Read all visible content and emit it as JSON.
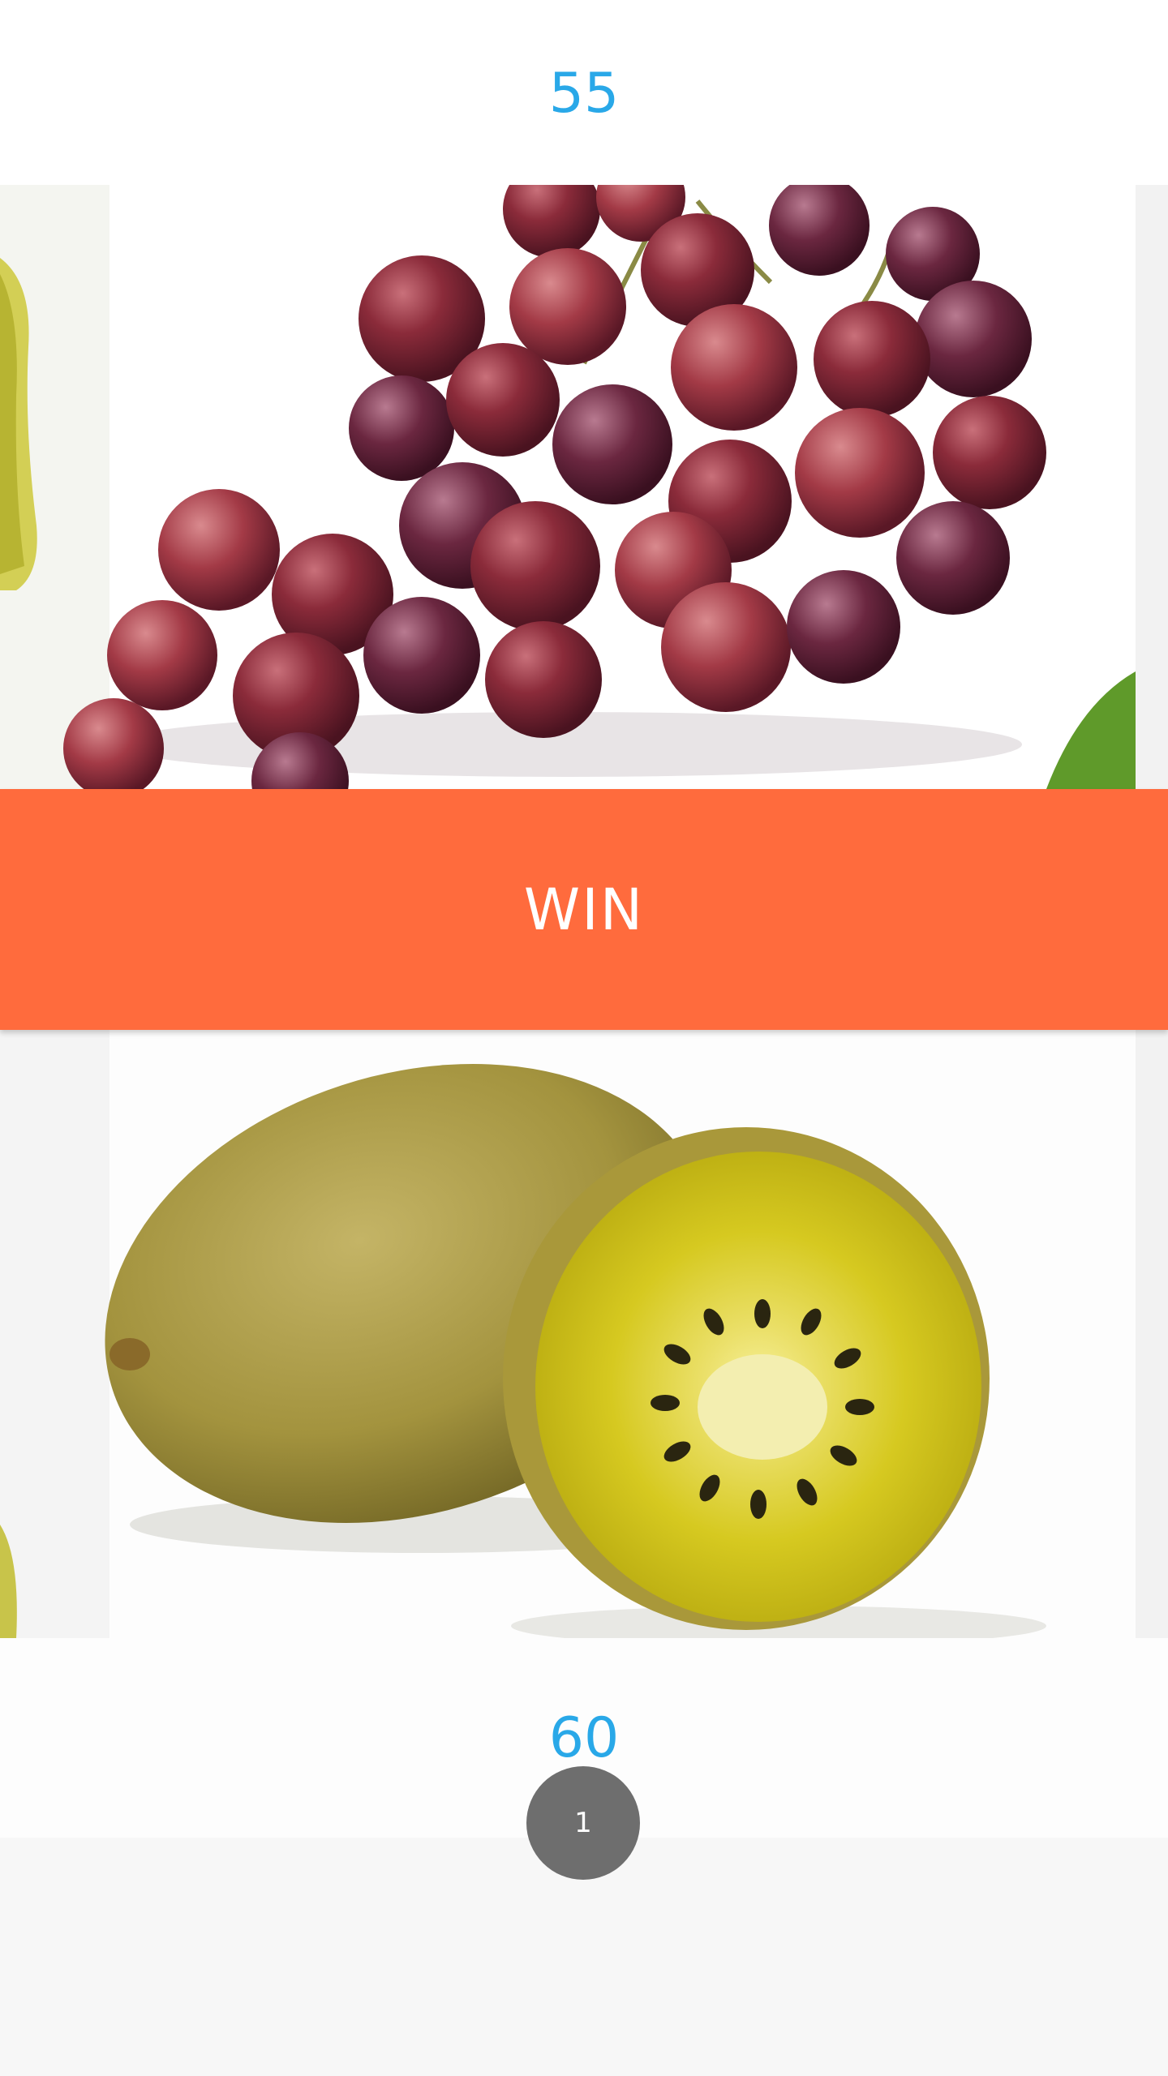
{
  "game": {
    "top_score": "55",
    "bottom_score": "60",
    "result_label": "WIN",
    "page_indicator": "1"
  },
  "images": {
    "top_fruit": "grapes-image",
    "bottom_fruit": "kiwi-image"
  },
  "colors": {
    "score_text": "#29a8e8",
    "win_bar": "#ff6b3d",
    "badge": "#6e6e6e"
  }
}
